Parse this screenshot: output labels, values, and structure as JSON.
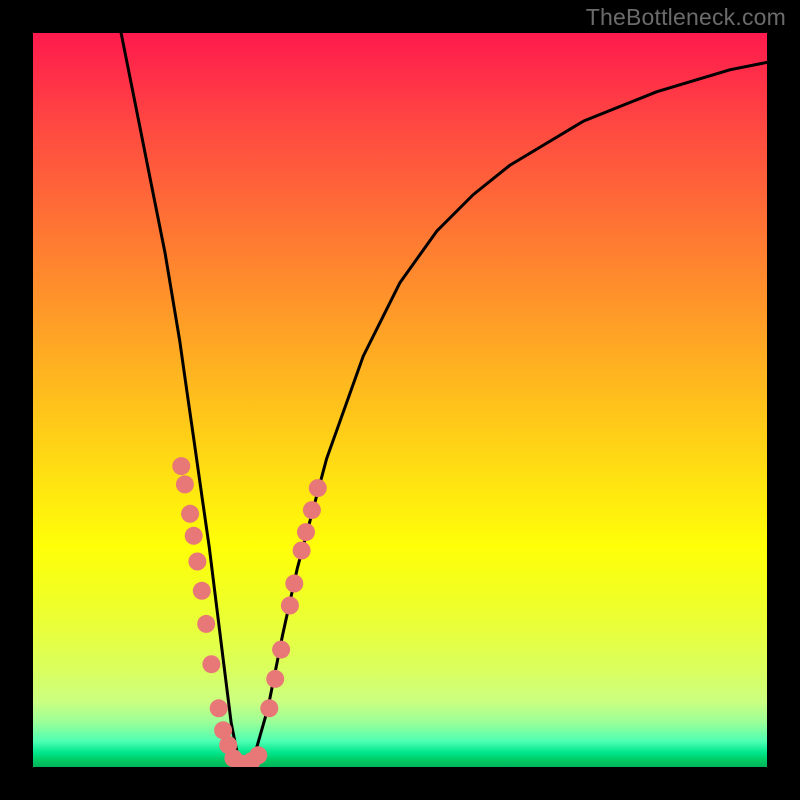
{
  "watermark": {
    "text": "TheBottleneck.com"
  },
  "chart_data": {
    "type": "line",
    "title": "",
    "xlabel": "",
    "ylabel": "",
    "xlim": [
      0,
      100
    ],
    "ylim": [
      0,
      100
    ],
    "grid": false,
    "legend": false,
    "series": [
      {
        "name": "v-curve",
        "color": "#000000",
        "x": [
          12,
          14,
          16,
          18,
          20,
          21,
          22,
          23,
          24,
          25,
          26,
          27,
          28,
          29,
          30,
          32,
          34,
          36,
          40,
          45,
          50,
          55,
          60,
          65,
          70,
          75,
          80,
          85,
          90,
          95,
          100
        ],
        "y": [
          100,
          90,
          80,
          70,
          58,
          51,
          44,
          37,
          30,
          22,
          14,
          6,
          1,
          0,
          1,
          8,
          18,
          27,
          42,
          56,
          66,
          73,
          78,
          82,
          85,
          88,
          90,
          92,
          93.5,
          95,
          96
        ]
      }
    ],
    "markers": [
      {
        "name": "left-branch-dots",
        "color": "#e87878",
        "shape": "circle",
        "points": [
          {
            "x": 20.2,
            "y": 41
          },
          {
            "x": 20.7,
            "y": 38.5
          },
          {
            "x": 21.4,
            "y": 34.5
          },
          {
            "x": 21.9,
            "y": 31.5
          },
          {
            "x": 22.4,
            "y": 28
          },
          {
            "x": 23.0,
            "y": 24
          },
          {
            "x": 23.6,
            "y": 19.5
          },
          {
            "x": 24.3,
            "y": 14
          },
          {
            "x": 25.3,
            "y": 8
          },
          {
            "x": 25.9,
            "y": 5
          },
          {
            "x": 26.6,
            "y": 3
          }
        ]
      },
      {
        "name": "trough-dots",
        "color": "#e87878",
        "shape": "circle",
        "points": [
          {
            "x": 27.3,
            "y": 1.2
          },
          {
            "x": 28.2,
            "y": 0.5
          },
          {
            "x": 29.0,
            "y": 0.4
          },
          {
            "x": 29.8,
            "y": 0.8
          },
          {
            "x": 30.7,
            "y": 1.6
          }
        ]
      },
      {
        "name": "right-branch-dots",
        "color": "#e87878",
        "shape": "circle",
        "points": [
          {
            "x": 32.2,
            "y": 8
          },
          {
            "x": 33.0,
            "y": 12
          },
          {
            "x": 33.8,
            "y": 16
          },
          {
            "x": 35.0,
            "y": 22
          },
          {
            "x": 35.6,
            "y": 25
          },
          {
            "x": 36.6,
            "y": 29.5
          },
          {
            "x": 37.2,
            "y": 32
          },
          {
            "x": 38.0,
            "y": 35
          },
          {
            "x": 38.8,
            "y": 38
          }
        ]
      }
    ]
  }
}
